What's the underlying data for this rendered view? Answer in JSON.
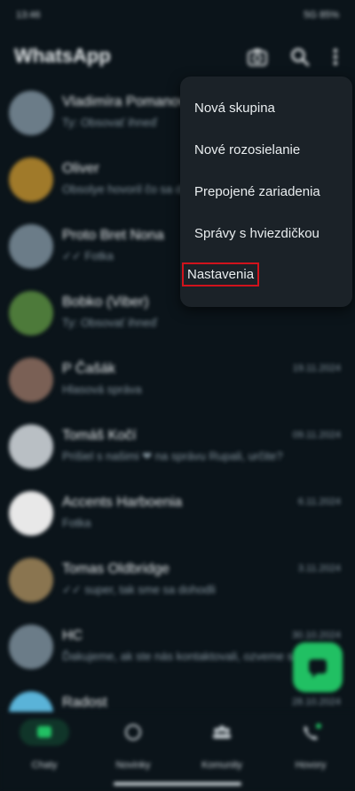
{
  "status_bar": {
    "time": "13:46",
    "right": "5G 85%"
  },
  "app": {
    "title": "WhatsApp"
  },
  "chats": [
    {
      "name": "Vladimíra Pomanová",
      "preview": "Ty: Obsovať ihneď",
      "time": ""
    },
    {
      "name": "Oliver",
      "preview": "Obsolye hovoril čo sa dalo",
      "time": ""
    },
    {
      "name": "Proto Bret Nona",
      "preview": "✓✓ Fotka",
      "time": ""
    },
    {
      "name": "Bobko (Viber)",
      "preview": "Ty: Obsovať ihneď",
      "time": ""
    },
    {
      "name": "P Čašák",
      "preview": "Hlasová správa",
      "time": "19.11.2024"
    },
    {
      "name": "Tomáš Kočí",
      "preview": "Prišiel s našimi ❤ na správu Rupali, určite?",
      "time": "09.11.2024"
    },
    {
      "name": "Accents Harboenia",
      "preview": "Fotka",
      "time": "6.11.2024"
    },
    {
      "name": "Tomas Oldbridge",
      "preview": "✓✓ super, tak sme sa dohodli",
      "time": "3.11.2024"
    },
    {
      "name": "HC",
      "preview": "Ďakujeme, ak ste nás kontaktovali, ozveme sa",
      "time": "30.10.2024"
    },
    {
      "name": "Radost",
      "preview": "",
      "time": "28.10.2024"
    }
  ],
  "bottom_nav": [
    {
      "label": "Chaty",
      "icon": "chat-icon"
    },
    {
      "label": "Novinky",
      "icon": "updates-icon"
    },
    {
      "label": "Komunity",
      "icon": "communities-icon"
    },
    {
      "label": "Hovory",
      "icon": "calls-icon"
    }
  ],
  "menu": {
    "items": [
      {
        "label": "Nová skupina"
      },
      {
        "label": "Nové rozosielanie"
      },
      {
        "label": "Prepojené zariadenia"
      },
      {
        "label": "Správy s hviezdičkou"
      },
      {
        "label": "Nastavenia"
      }
    ]
  },
  "colors": {
    "background": "#0b141a",
    "menu": "#1b2228",
    "accent": "#21c063",
    "highlight": "#d0131c"
  }
}
